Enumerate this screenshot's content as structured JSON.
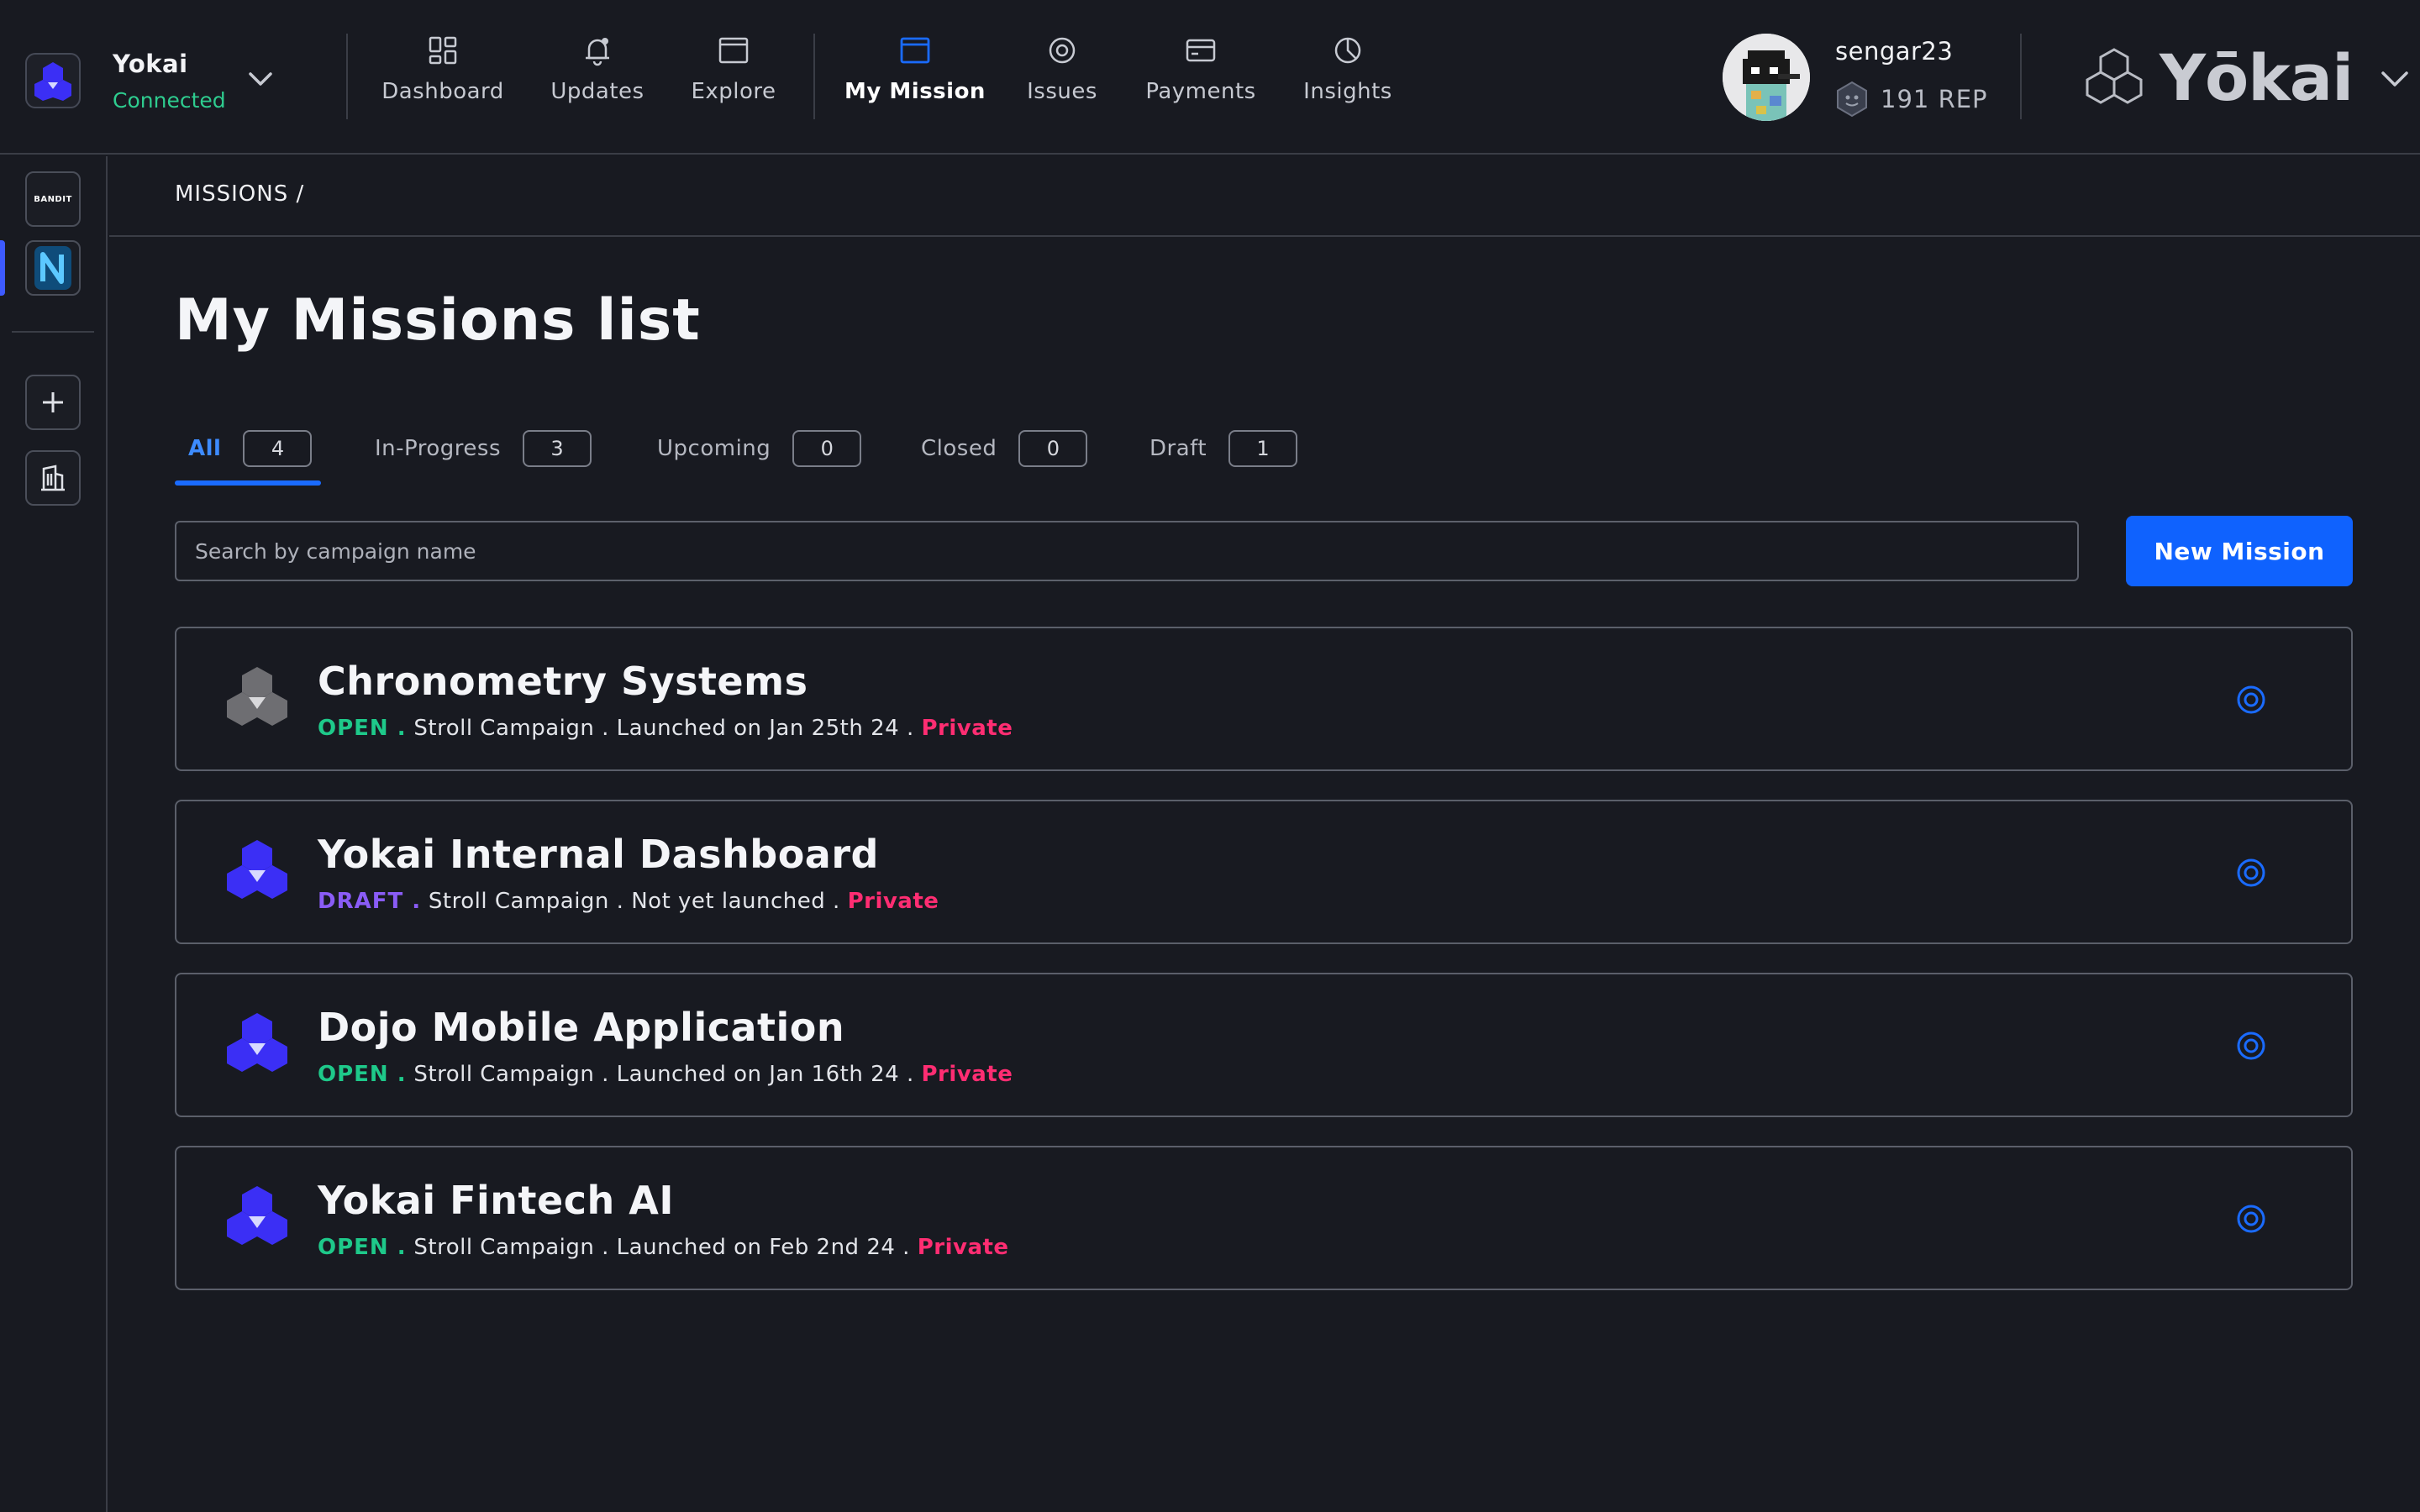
{
  "org": {
    "name": "Yokai",
    "status": "Connected"
  },
  "nav": [
    {
      "label": "Dashboard",
      "icon": "grid-icon",
      "active": false
    },
    {
      "label": "Updates",
      "icon": "bell-icon",
      "active": false
    },
    {
      "label": "Explore",
      "icon": "window-icon",
      "active": false
    },
    {
      "label": "My Mission",
      "icon": "window-icon",
      "active": true
    },
    {
      "label": "Issues",
      "icon": "target-icon",
      "active": false
    },
    {
      "label": "Payments",
      "icon": "card-icon",
      "active": false
    },
    {
      "label": "Insights",
      "icon": "pie-icon",
      "active": false
    }
  ],
  "user": {
    "name": "sengar23",
    "rep": "191 REP"
  },
  "brand": {
    "name": "Yōkai"
  },
  "rail": {
    "items": [
      "BANDIT",
      "N"
    ]
  },
  "breadcrumb": "MISSIONS /",
  "page": {
    "title": "My Missions list"
  },
  "tabs": [
    {
      "label": "All",
      "count": "4",
      "active": true
    },
    {
      "label": "In-Progress",
      "count": "3",
      "active": false
    },
    {
      "label": "Upcoming",
      "count": "0",
      "active": false
    },
    {
      "label": "Closed",
      "count": "0",
      "active": false
    },
    {
      "label": "Draft",
      "count": "1",
      "active": false
    }
  ],
  "search": {
    "placeholder": "Search by campaign name",
    "value": ""
  },
  "new_mission_label": "New Mission",
  "missions": [
    {
      "title": "Chronometry Systems",
      "status": "OPEN .",
      "type": "Stroll Campaign .",
      "launch": "Launched on Jan 25th 24 .",
      "visibility": "Private",
      "logo": "grey"
    },
    {
      "title": "Yokai Internal Dashboard",
      "status": "DRAFT .",
      "type": "Stroll Campaign .",
      "launch": "Not yet launched .",
      "visibility": "Private",
      "logo": "blue"
    },
    {
      "title": "Dojo Mobile Application",
      "status": "OPEN .",
      "type": "Stroll Campaign .",
      "launch": "Launched on Jan 16th 24 .",
      "visibility": "Private",
      "logo": "blue"
    },
    {
      "title": "Yokai Fintech AI",
      "status": "OPEN .",
      "type": "Stroll Campaign .",
      "launch": "Launched on Feb 2nd 24 .",
      "visibility": "Private",
      "logo": "blue"
    }
  ],
  "colors": {
    "accent": "#0f62fe",
    "open": "#1ec98a",
    "draft": "#8a5cf6",
    "private": "#ff2d72",
    "background": "#181a21"
  }
}
